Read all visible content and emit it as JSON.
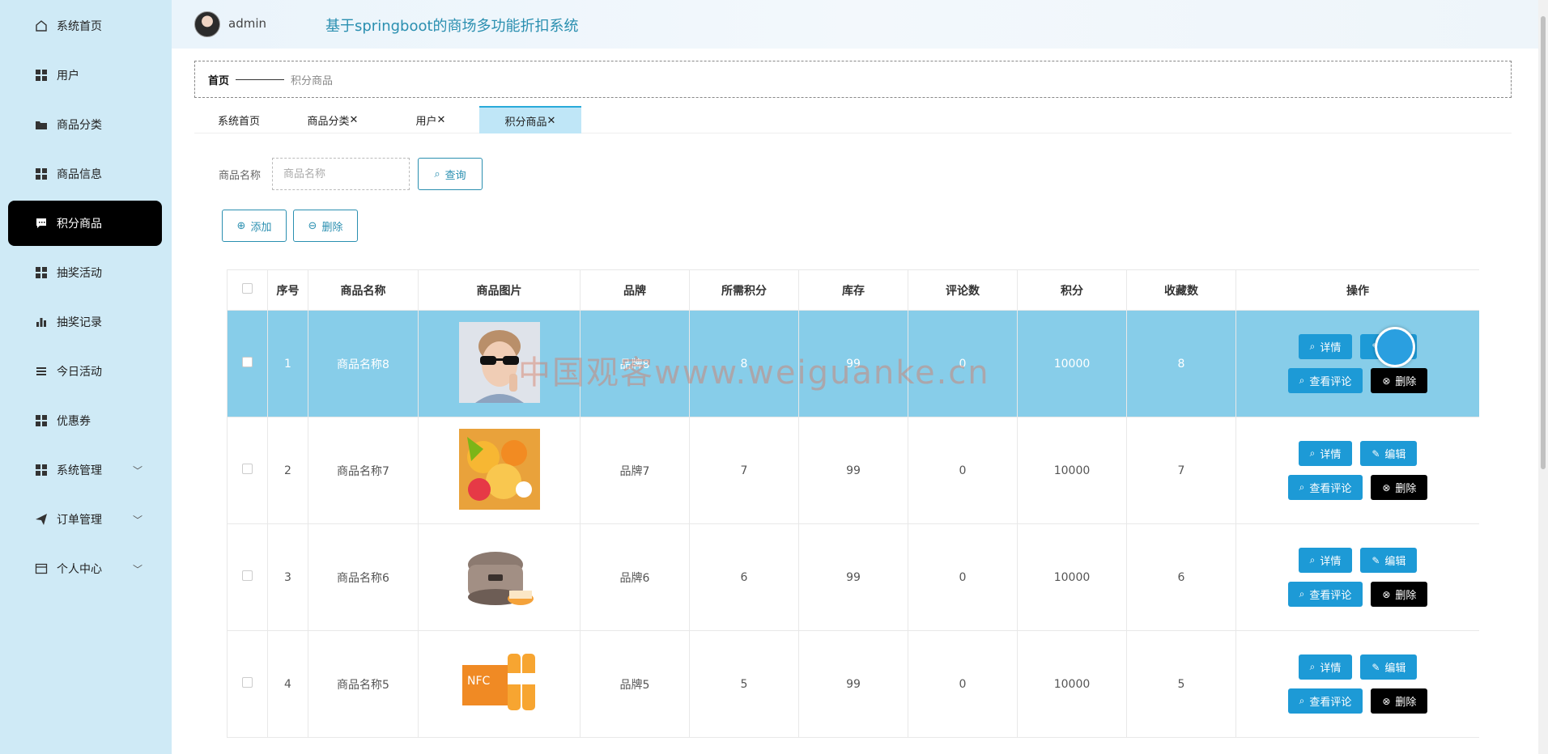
{
  "sidebar": {
    "items": [
      {
        "label": "系统首页",
        "icon": "home-icon",
        "active": false,
        "has_children": false
      },
      {
        "label": "用户",
        "icon": "grid-icon",
        "active": false,
        "has_children": false
      },
      {
        "label": "商品分类",
        "icon": "folder-icon",
        "active": false,
        "has_children": false
      },
      {
        "label": "商品信息",
        "icon": "grid-icon",
        "active": false,
        "has_children": false
      },
      {
        "label": "积分商品",
        "icon": "chat-icon",
        "active": true,
        "has_children": false
      },
      {
        "label": "抽奖活动",
        "icon": "grid-icon",
        "active": false,
        "has_children": false
      },
      {
        "label": "抽奖记录",
        "icon": "bar-chart-icon",
        "active": false,
        "has_children": false
      },
      {
        "label": "今日活动",
        "icon": "list-icon",
        "active": false,
        "has_children": false
      },
      {
        "label": "优惠券",
        "icon": "grid-icon",
        "active": false,
        "has_children": false
      },
      {
        "label": "系统管理",
        "icon": "grid-icon",
        "active": false,
        "has_children": true
      },
      {
        "label": "订单管理",
        "icon": "send-icon",
        "active": false,
        "has_children": true
      },
      {
        "label": "个人中心",
        "icon": "card-icon",
        "active": false,
        "has_children": true
      }
    ]
  },
  "header": {
    "username": "admin",
    "title": "基于springboot的商场多功能折扣系统"
  },
  "breadcrumb": {
    "home": "首页",
    "current": "积分商品"
  },
  "tabs": [
    {
      "label": "系统首页",
      "closable": false,
      "active": false
    },
    {
      "label": "商品分类",
      "closable": true,
      "active": false
    },
    {
      "label": "用户",
      "closable": true,
      "active": false
    },
    {
      "label": "积分商品",
      "closable": true,
      "active": true
    }
  ],
  "close_glyph": "✕",
  "search": {
    "label": "商品名称",
    "placeholder": "商品名称",
    "value": "",
    "query_button": "查询"
  },
  "actions": {
    "add_button": "添加",
    "delete_button": "删除"
  },
  "table": {
    "columns": [
      "",
      "序号",
      "商品名称",
      "商品图片",
      "品牌",
      "所需积分",
      "库存",
      "评论数",
      "积分",
      "收藏数",
      "操作"
    ],
    "rows": [
      {
        "index": "1",
        "name": "商品名称8",
        "image": "sunglasses-man-image",
        "brand": "品牌8",
        "points_required": "8",
        "stock": "99",
        "comments": "0",
        "points": "10000",
        "favorites": "8",
        "selected": true
      },
      {
        "index": "2",
        "name": "商品名称7",
        "image": "fruit-platter-image",
        "brand": "品牌7",
        "points_required": "7",
        "stock": "99",
        "comments": "0",
        "points": "10000",
        "favorites": "7",
        "selected": false
      },
      {
        "index": "3",
        "name": "商品名称6",
        "image": "rice-cooker-image",
        "brand": "品牌6",
        "points_required": "6",
        "stock": "99",
        "comments": "0",
        "points": "10000",
        "favorites": "6",
        "selected": false
      },
      {
        "index": "4",
        "name": "商品名称5",
        "image": "nfc-juice-image",
        "brand": "品牌5",
        "points_required": "5",
        "stock": "99",
        "comments": "0",
        "points": "10000",
        "favorites": "5",
        "selected": false
      }
    ],
    "row_actions": {
      "detail": "详情",
      "edit": "编辑",
      "view_comments": "查看评论",
      "delete": "删除"
    }
  },
  "watermark": "中国观客www.weiguanke.cn",
  "colors": {
    "sidebar_bg": "#cfeaf6",
    "active_menu_bg": "#000000",
    "accent": "#2a8fb0",
    "button_blue": "#1d9ad6",
    "selected_row": "#87cde9",
    "active_tab": "#bfe6f7"
  }
}
